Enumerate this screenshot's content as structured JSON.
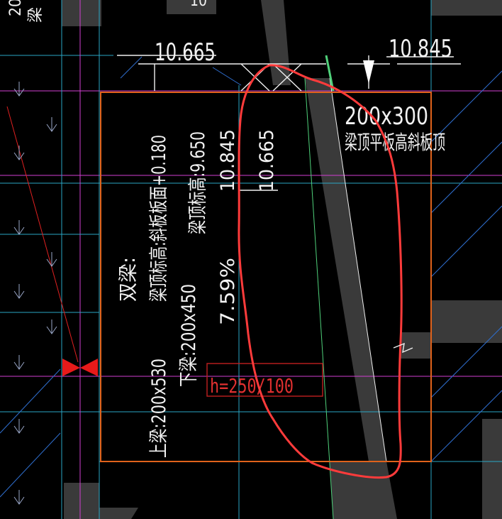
{
  "elevations": {
    "left_top": "10.665",
    "right_top": "10.845"
  },
  "top_right_note": {
    "size": "200x300",
    "desc": "梁顶平板高斜板顶"
  },
  "vertical_text": {
    "col1": "双梁:",
    "col2": "梁顶标高:斜板板面+0.180",
    "col3": "梁顶标高:9.650",
    "col4": "10.845",
    "col5": "10.665",
    "lower_a": "上梁:200x530",
    "lower_b": "下梁:200x450",
    "lower_c": "7.59%"
  },
  "slab_label": "h=250/100",
  "corner_fragments": {
    "tl_a": "20",
    "tl_b": "梁",
    "top_mid": "10"
  },
  "colors": {
    "frame": "#e0621b",
    "highlight": "#ff3b3b",
    "green": "#4fd07a",
    "magenta": "#d23fd2",
    "cyan": "#2aa6c4",
    "text": "#f2f2f2",
    "grey_fill": "#3a3a3a"
  }
}
